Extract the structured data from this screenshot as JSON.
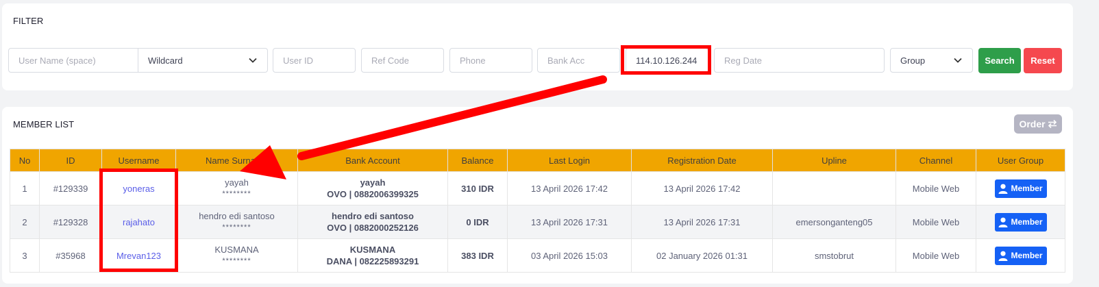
{
  "filter": {
    "title": "FILTER",
    "username_placeholder": "User Name (space)",
    "match_mode": "Wildcard",
    "user_id_placeholder": "User ID",
    "ref_code_placeholder": "Ref Code",
    "phone_placeholder": "Phone",
    "bank_acc_placeholder": "Bank Acc",
    "ip_value": "114.10.126.244",
    "reg_date_placeholder": "Reg Date",
    "group_label": "Group",
    "search_label": "Search",
    "reset_label": "Reset"
  },
  "member_list": {
    "title": "MEMBER LIST",
    "order_label": "Order",
    "columns": [
      "No",
      "ID",
      "Username",
      "Name Surname",
      "Bank Account",
      "Balance",
      "Last Login",
      "Registration Date",
      "Upline",
      "Channel",
      "User Group"
    ],
    "rows": [
      {
        "no": "1",
        "id": "#129339",
        "username": "yoneras",
        "name": "yayah",
        "name_mask": "********",
        "bank_name": "yayah",
        "bank_detail": "OVO | 0882006399325",
        "balance": "310 IDR",
        "last_login": "13 April 2026 17:42",
        "reg_date": "13 April 2026 17:42",
        "upline": "",
        "channel": "Mobile Web",
        "group": "Member"
      },
      {
        "no": "2",
        "id": "#129328",
        "username": "rajahato",
        "name": "hendro edi santoso",
        "name_mask": "********",
        "bank_name": "hendro edi santoso",
        "bank_detail": "OVO | 0882000252126",
        "balance": "0 IDR",
        "last_login": "13 April 2026 17:31",
        "reg_date": "13 April 2026 17:31",
        "upline": "emersonganteng05",
        "channel": "Mobile Web",
        "group": "Member"
      },
      {
        "no": "3",
        "id": "#35968",
        "username": "Mrevan123",
        "name": "KUSMANA",
        "name_mask": "********",
        "bank_name": "KUSMANA",
        "bank_detail": "DANA | 082225893291",
        "balance": "383 IDR",
        "last_login": "03 April 2026 15:03",
        "reg_date": "02 January 2026 01:31",
        "upline": "smstobrut",
        "channel": "Mobile Web",
        "group": "Member"
      }
    ]
  },
  "colors": {
    "header_bg": "#f0a500",
    "search": "#2e9e4a",
    "reset": "#f5484e",
    "badge": "#1561f5",
    "annotation": "#ff0000"
  }
}
